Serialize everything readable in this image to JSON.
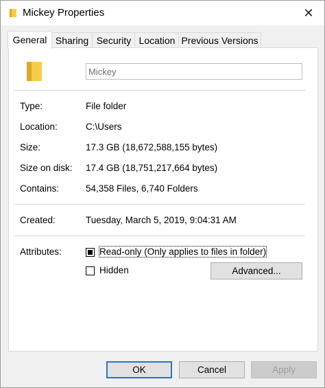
{
  "window": {
    "title": "Mickey Properties",
    "close_glyph": "✕"
  },
  "tabs": [
    {
      "label": "General"
    },
    {
      "label": "Sharing"
    },
    {
      "label": "Security"
    },
    {
      "label": "Location"
    },
    {
      "label": "Previous Versions"
    }
  ],
  "general": {
    "name_value": "Mickey",
    "rows": [
      {
        "label": "Type:",
        "value": "File folder"
      },
      {
        "label": "Location:",
        "value": "C:\\Users"
      },
      {
        "label": "Size:",
        "value": "17.3 GB (18,672,588,155 bytes)"
      },
      {
        "label": "Size on disk:",
        "value": "17.4 GB (18,751,217,664 bytes)"
      },
      {
        "label": "Contains:",
        "value": "54,358 Files, 6,740 Folders"
      },
      {
        "label": "Created:",
        "value": "Tuesday, March 5, 2019, 9:04:31 AM"
      }
    ],
    "attributes_label": "Attributes:",
    "readonly_label": "Read-only (Only applies to files in folder)",
    "hidden_label": "Hidden",
    "advanced_label": "Advanced..."
  },
  "buttons": {
    "ok": "OK",
    "cancel": "Cancel",
    "apply": "Apply"
  },
  "colors": {
    "folder_yellow": "#f6cd4a",
    "folder_dark": "#dca92a",
    "default_border": "#2b73c6"
  },
  "icons": {
    "title": "folder-icon",
    "large": "folder-icon"
  }
}
